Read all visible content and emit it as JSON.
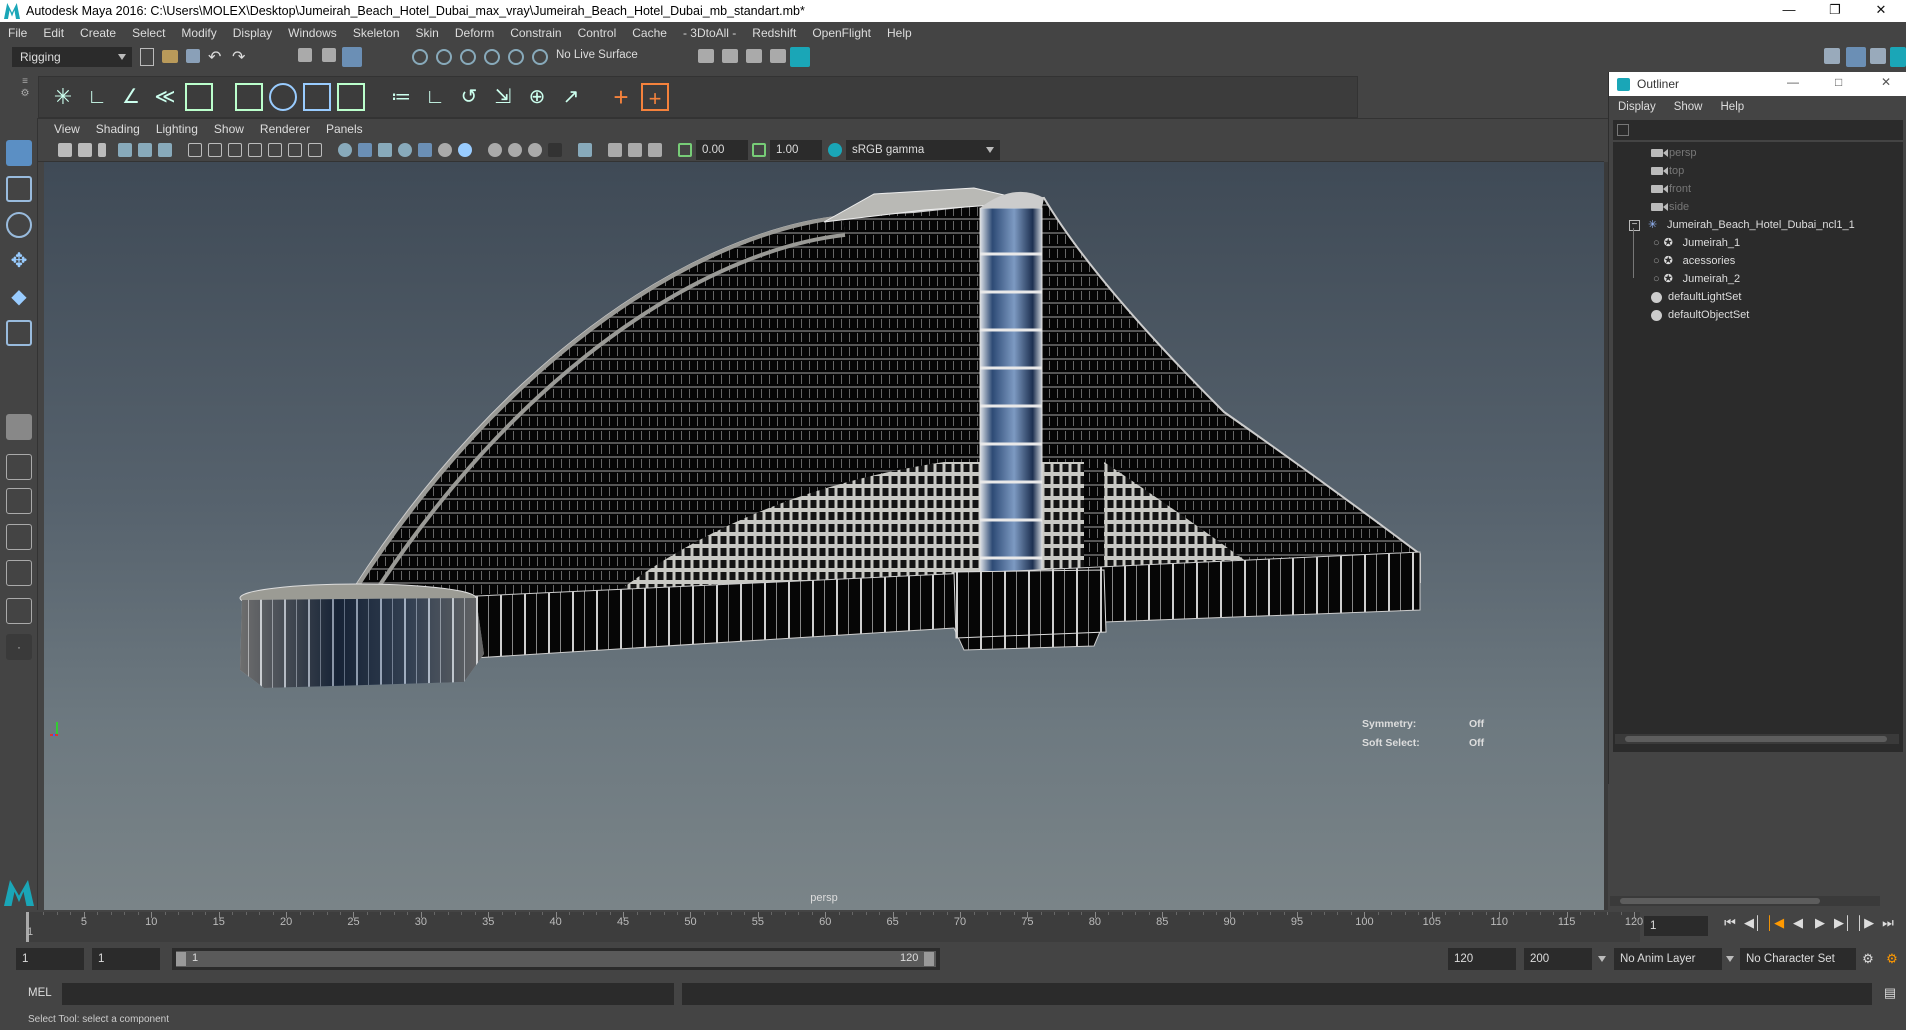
{
  "window": {
    "title": "Autodesk Maya 2016: C:\\Users\\MOLEX\\Desktop\\Jumeirah_Beach_Hotel_Dubai_max_vray\\Jumeirah_Beach_Hotel_Dubai_mb_standart.mb*"
  },
  "menu": [
    "File",
    "Edit",
    "Create",
    "Select",
    "Modify",
    "Display",
    "Windows",
    "Skeleton",
    "Skin",
    "Deform",
    "Constrain",
    "Control",
    "Cache",
    "- 3DtoAll -",
    "Redshift",
    "OpenFlight",
    "Help"
  ],
  "status": {
    "menuset": "Rigging",
    "live_surface": "No Live Surface"
  },
  "panel": {
    "menu": [
      "View",
      "Shading",
      "Lighting",
      "Show",
      "Renderer",
      "Panels"
    ],
    "exposure": "0.00",
    "gamma": "1.00",
    "colorspace": "sRGB gamma",
    "camera_label": "persp",
    "symmetry_label": "Symmetry:",
    "symmetry_value": "Off",
    "soft_select_label": "Soft Select:",
    "soft_select_value": "Off"
  },
  "outliner": {
    "title": "Outliner",
    "menu": [
      "Display",
      "Show",
      "Help"
    ],
    "items": [
      {
        "label": "persp",
        "dim": true
      },
      {
        "label": "top",
        "dim": true
      },
      {
        "label": "front",
        "dim": true
      },
      {
        "label": "side",
        "dim": true
      },
      {
        "label": "Jumeirah_Beach_Hotel_Dubai_ncl1_1",
        "dim": false
      },
      {
        "label": "Jumeirah_1",
        "dim": false
      },
      {
        "label": "acessories",
        "dim": false
      },
      {
        "label": "Jumeirah_2",
        "dim": false
      },
      {
        "label": "defaultLightSet",
        "dim": false
      },
      {
        "label": "defaultObjectSet",
        "dim": false
      }
    ]
  },
  "timeline": {
    "ticks": [
      "5",
      "10",
      "15",
      "20",
      "25",
      "30",
      "35",
      "40",
      "45",
      "50",
      "55",
      "60",
      "65",
      "70",
      "75",
      "80",
      "85",
      "90",
      "95",
      "100",
      "105",
      "110",
      "115",
      "120"
    ],
    "start_marker": "1",
    "current_frame": "1"
  },
  "range": {
    "start": "1",
    "playback_start": "1",
    "slider_start": "1",
    "slider_end": "120",
    "playback_end": "120",
    "end": "200",
    "anim_layer": "No Anim Layer",
    "character_set": "No Character Set"
  },
  "command": {
    "label": "MEL"
  },
  "help_line": "Select Tool: select a component",
  "colors": {
    "ui_bg": "#444444",
    "field_bg": "#2b2b2b",
    "accent": "#1aa6b7"
  }
}
